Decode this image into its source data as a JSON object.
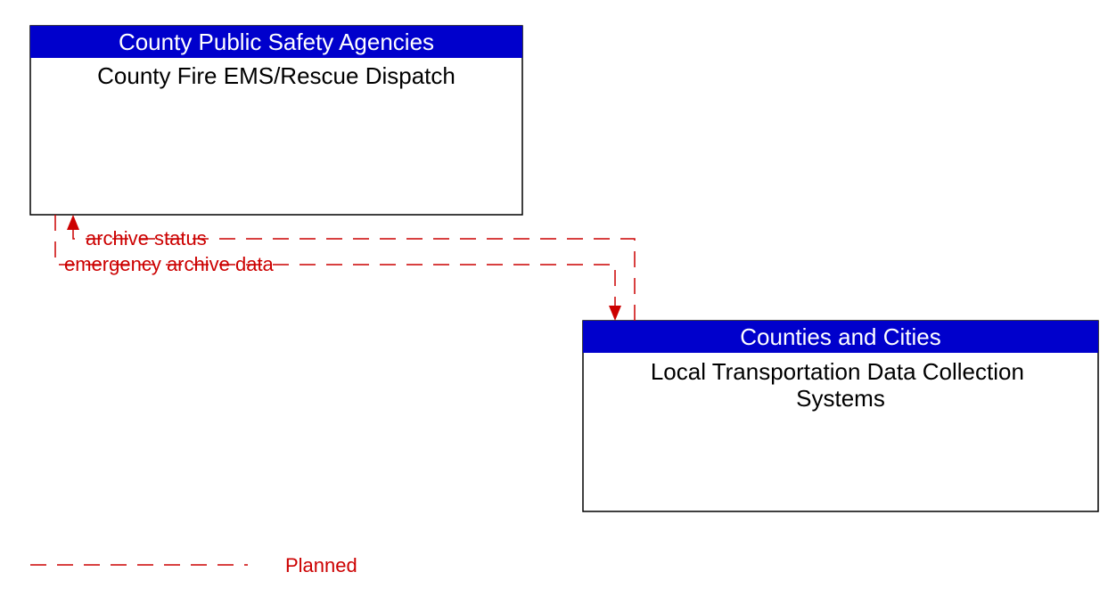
{
  "boxes": {
    "top": {
      "header": "County Public Safety Agencies",
      "body": "County Fire EMS/Rescue Dispatch"
    },
    "bottom": {
      "header": "Counties and Cities",
      "body": "Local Transportation Data Collection Systems"
    }
  },
  "flows": {
    "to_top": "archive status",
    "to_bottom": "emergency archive data"
  },
  "legend": {
    "planned": "Planned"
  }
}
